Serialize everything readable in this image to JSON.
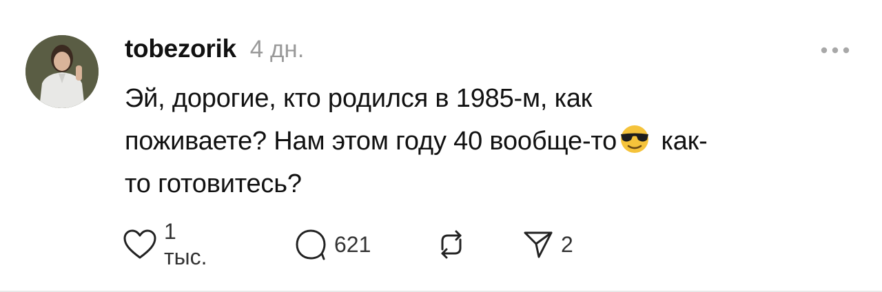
{
  "post": {
    "username": "tobezorik",
    "time": "4 дн.",
    "text_lines": [
      "Эй, дорогие, кто родился в 1985-м, как",
      "поживаете? Нам этом году 40 вообще-то",
      "как-",
      "то готовитесь?"
    ],
    "emoji_name": "smiling-face-with-sunglasses"
  },
  "actions": {
    "likes": "1 тыс.",
    "replies": "621",
    "shares": "2"
  },
  "icons": [
    "more-icon",
    "heart-icon",
    "comment-icon",
    "repost-icon",
    "share-icon"
  ],
  "colors": {
    "text": "#111111",
    "muted": "#9a9a9a",
    "emoji_face": "#f5c33b"
  }
}
